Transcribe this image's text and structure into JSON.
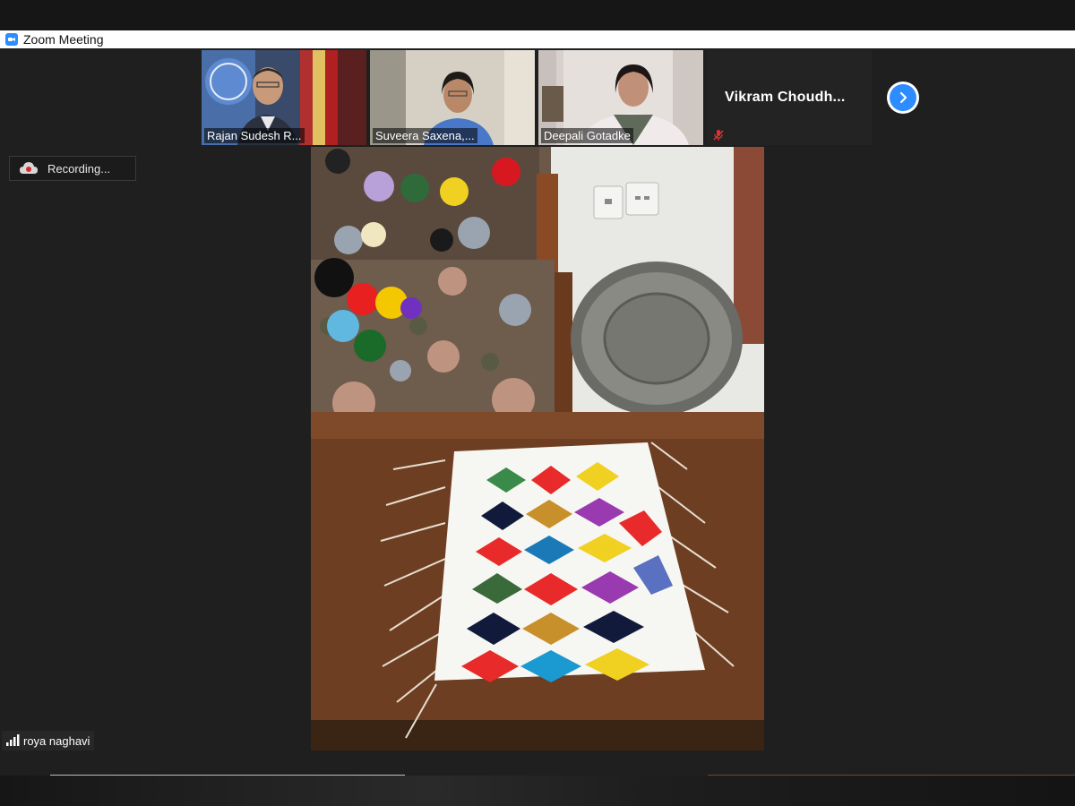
{
  "window": {
    "title": "Zoom Meeting",
    "app_icon": "zoom-camera-icon",
    "accent": "#2d8cff"
  },
  "participants": [
    {
      "name": "Rajan Sudesh R...",
      "video": true
    },
    {
      "name": "Suveera Saxena,...",
      "video": true
    },
    {
      "name": "Deepali Gotadke",
      "video": true
    },
    {
      "name": "Vikram  Choudh...",
      "video": false,
      "muted": true
    }
  ],
  "next_page_icon": "chevron-right-icon",
  "recording": {
    "label": "Recording...",
    "icon": "cloud-recording-icon"
  },
  "active_speaker": {
    "name": "roya naghavi",
    "icon": "signal-bars-icon"
  },
  "main_video": {
    "description_icon": "shared-video-feed"
  }
}
